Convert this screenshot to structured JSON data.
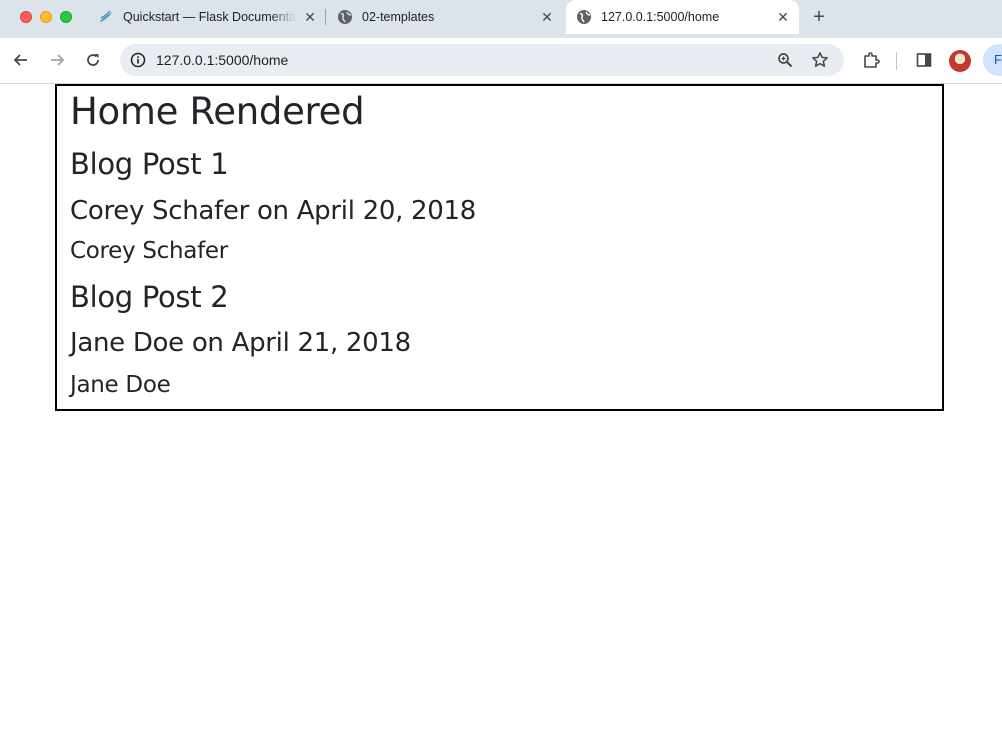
{
  "browser": {
    "tabs": [
      {
        "title": "Quickstart — Flask Documentation",
        "favicon": "flask-icon",
        "active": false
      },
      {
        "title": "02-templates",
        "favicon": "globe-icon",
        "active": false
      },
      {
        "title": "127.0.0.1:5000/home",
        "favicon": "globe-icon",
        "active": true
      }
    ],
    "address": "127.0.0.1:5000/home",
    "profile_initial": "F",
    "colors": {
      "tabstrip": "#dde3ea",
      "omnibox": "#e9edf3",
      "profile_chip": "#d3e3fd",
      "traffic_red": "#ff5f57",
      "traffic_yellow": "#febc2e",
      "traffic_green": "#28c840"
    }
  },
  "page": {
    "title": "Home Rendered",
    "posts": [
      {
        "title": "Blog Post 1",
        "meta": "Corey Schafer on April 20, 2018",
        "author": "Corey Schafer"
      },
      {
        "title": "Blog Post 2",
        "meta": "Jane Doe on April 21, 2018",
        "author": "Jane Doe"
      }
    ]
  }
}
